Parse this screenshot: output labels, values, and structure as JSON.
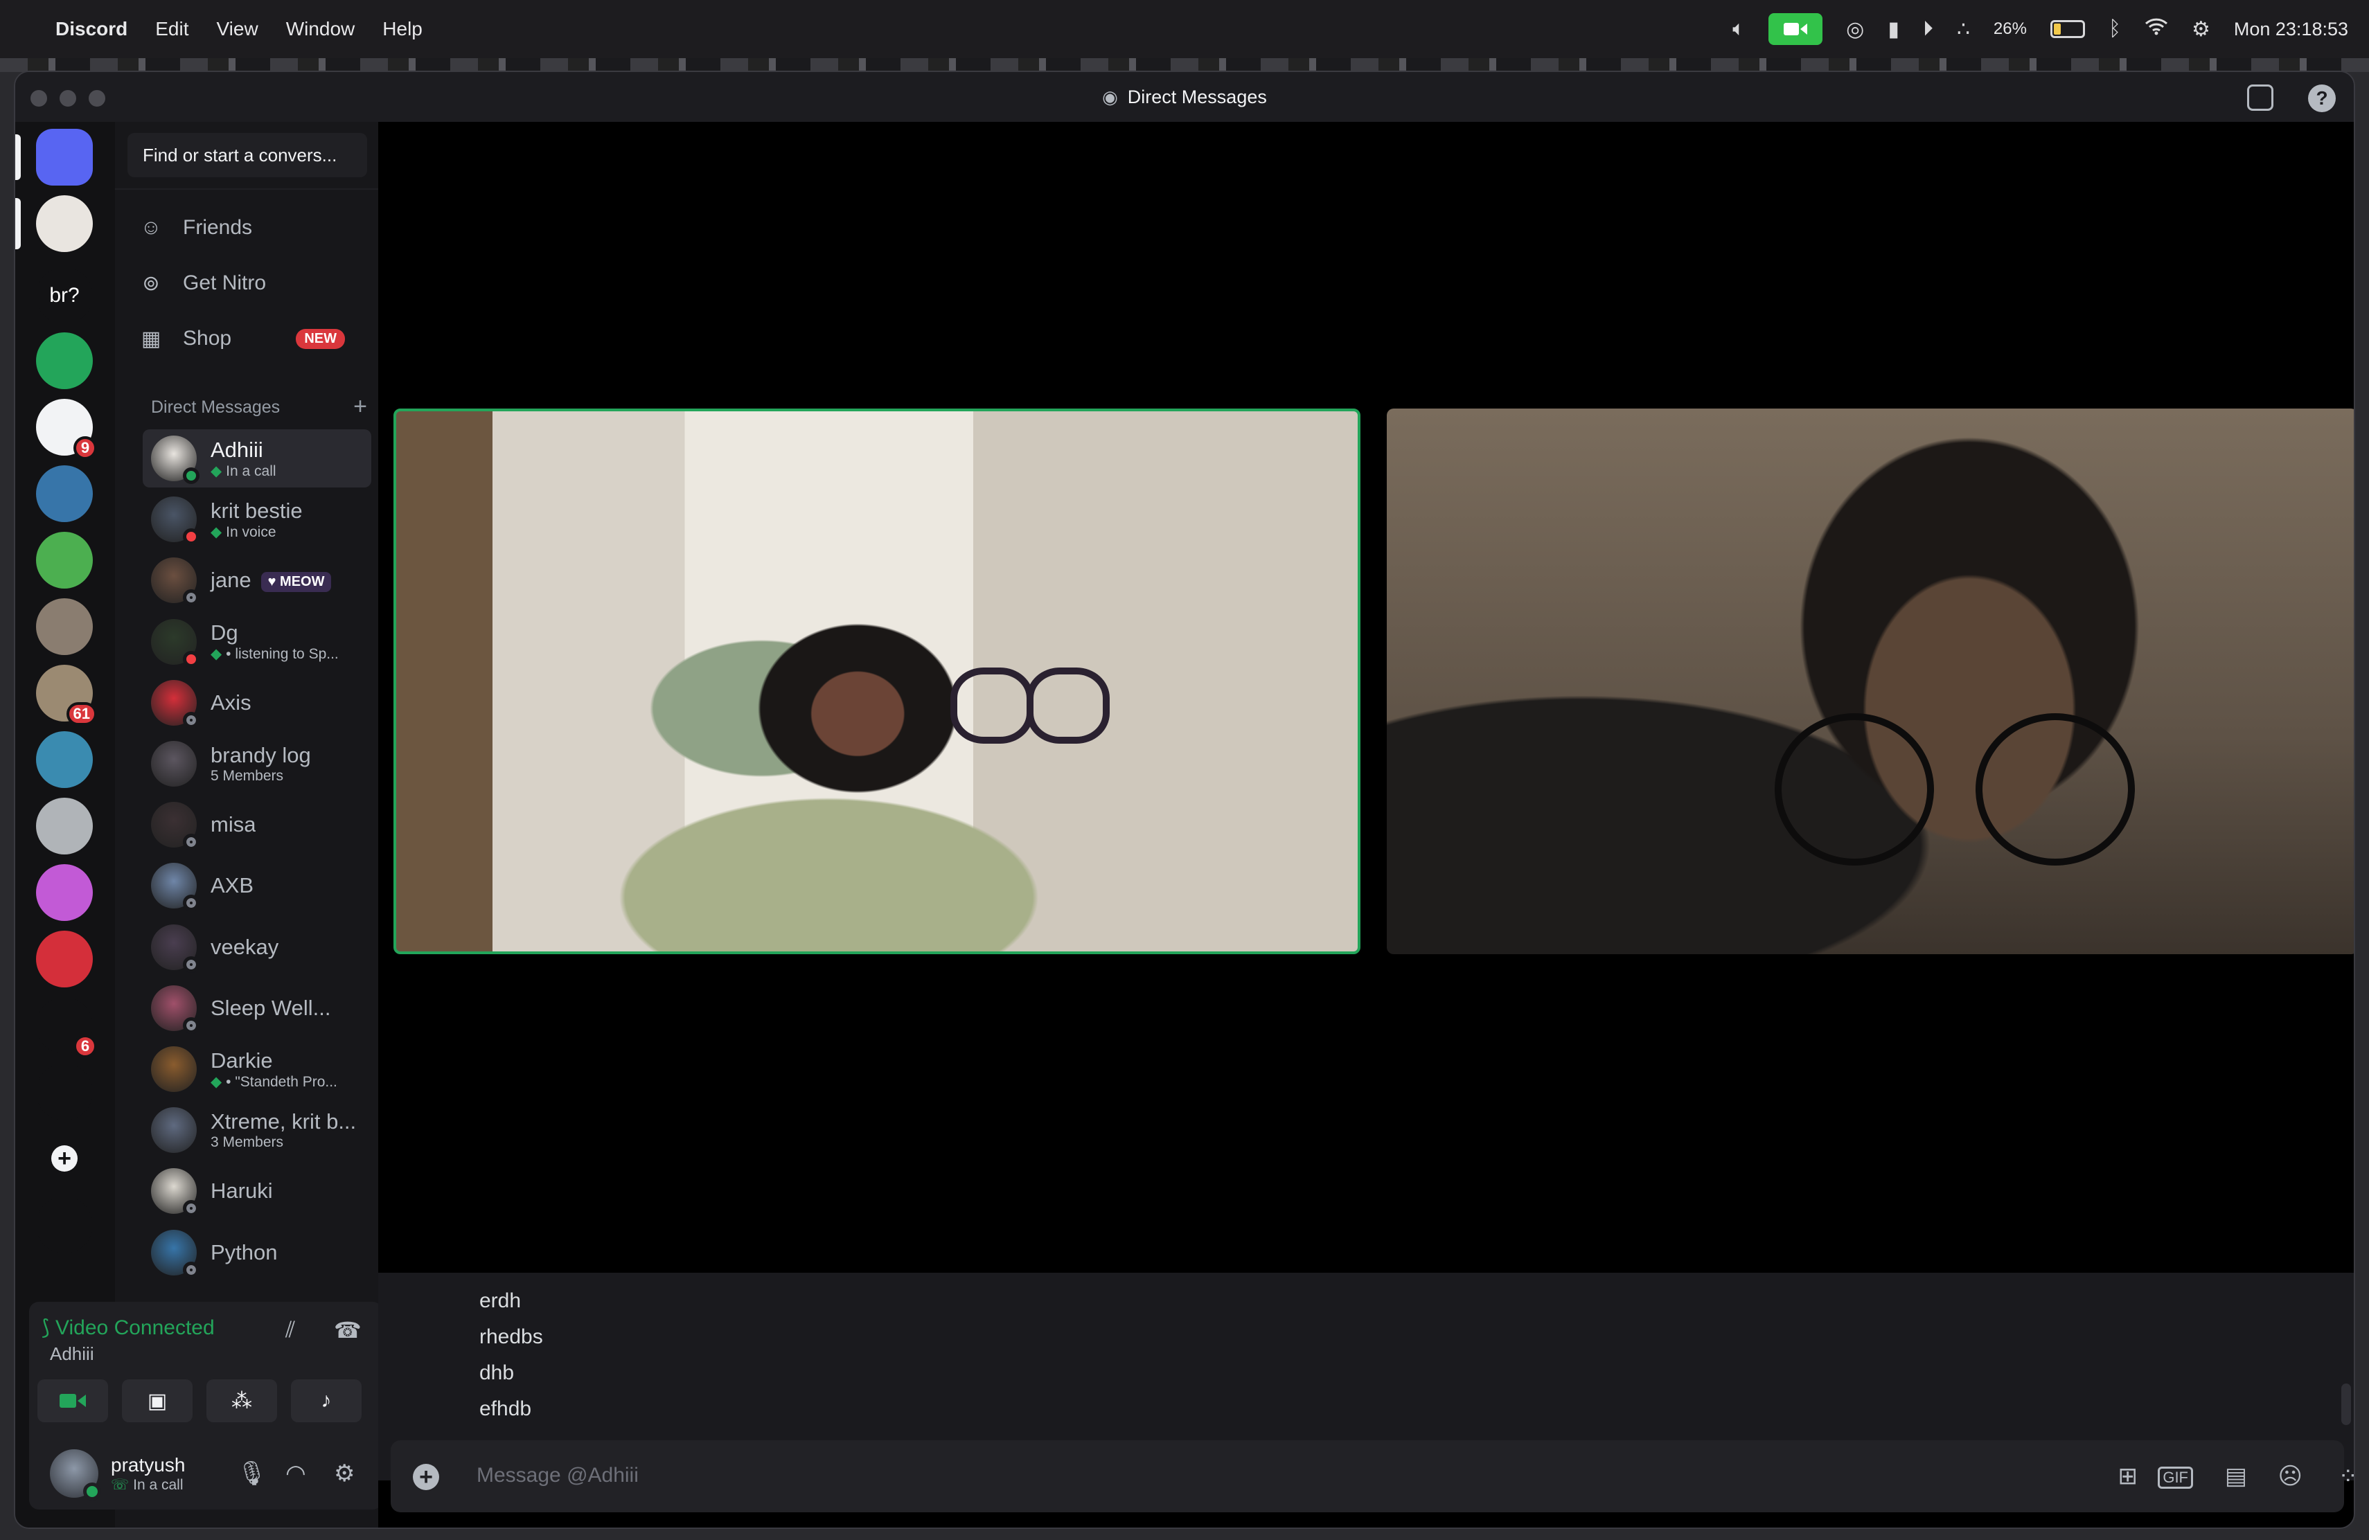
{
  "menubar": {
    "app_name": "Discord",
    "menus": [
      "Edit",
      "View",
      "Window",
      "Help"
    ],
    "battery_percent": "26%",
    "battery_level": 0.26,
    "clock": "Mon 23:18:53"
  },
  "window": {
    "title": "Direct Messages"
  },
  "servers": [
    {
      "label": "",
      "icon": "discord-home-icon",
      "color": "#5865f2"
    },
    {
      "label": "",
      "icon": "user-avatar",
      "color": "#e9e5e0"
    },
    {
      "label": "br?",
      "icon": "",
      "color": "#121214"
    },
    {
      "label": "",
      "icon": "head-logo-icon",
      "color": "#23a55a"
    },
    {
      "label": "",
      "icon": "anime-avatar",
      "color": "#f2f3f5",
      "badge": "9"
    },
    {
      "label": "",
      "icon": "python-logo",
      "color": "#3775a9"
    },
    {
      "label": "",
      "icon": "game-character-icon",
      "color": "#4caf50"
    },
    {
      "label": "",
      "icon": "photo-server",
      "color": "#8a7d70"
    },
    {
      "label": "",
      "icon": "landscape-server",
      "color": "#9b8a72",
      "badge": "61"
    },
    {
      "label": "",
      "icon": "cat-avatar",
      "color": "#3a8bb0"
    },
    {
      "label": "",
      "icon": "drone-server",
      "color": "#b0b4b8"
    },
    {
      "label": "",
      "icon": "rainbow-cat-server",
      "color": "#c25ad6"
    },
    {
      "label": "",
      "icon": "red-server",
      "color": "#d42f3a"
    },
    {
      "label": "",
      "icon": "rainbow-ring-server",
      "color": "#121214",
      "badge": "6"
    },
    {
      "label": "",
      "icon": "network-icon",
      "color": "#121214"
    },
    {
      "label": "+",
      "icon": "add-server-icon",
      "color": "#121214"
    },
    {
      "label": "",
      "icon": "explore-icon",
      "color": "#121214"
    }
  ],
  "sidebar": {
    "search_placeholder": "Find or start a convers...",
    "nav": [
      {
        "label": "Friends",
        "icon": "friends-icon"
      },
      {
        "label": "Get Nitro",
        "icon": "nitro-icon"
      },
      {
        "label": "Shop",
        "icon": "shop-icon",
        "badge": "NEW"
      }
    ],
    "dm_header": "Direct Messages",
    "dms": [
      {
        "name": "Adhiii",
        "sub": "In a call",
        "status": "online",
        "active": true,
        "color": "#e8e4df"
      },
      {
        "name": "krit bestie",
        "sub": "In voice",
        "status": "dnd",
        "color": "#4a5566"
      },
      {
        "name": "jane",
        "tag": "MEOW",
        "status": "off",
        "color": "#6b4f40"
      },
      {
        "name": "Dg",
        "sub": "• listening to Sp...",
        "status": "dnd",
        "color": "#2c3a2a"
      },
      {
        "name": "Axis",
        "status": "off",
        "color": "#d42f3a"
      },
      {
        "name": "brandy log",
        "sub": "5 Members",
        "status": "",
        "color": "#5c5660"
      },
      {
        "name": "misa",
        "status": "off",
        "color": "#3b3033"
      },
      {
        "name": "AXB",
        "status": "off",
        "color": "#6f86a8"
      },
      {
        "name": "veekay",
        "status": "off",
        "color": "#4a3e50"
      },
      {
        "name": "Sleep Well...",
        "status": "off",
        "color": "#a0506a"
      },
      {
        "name": "Darkie",
        "sub": "• \"Standeth Pro...",
        "status": "",
        "color": "#8a5c2e"
      },
      {
        "name": "Xtreme, krit b...",
        "sub": "3 Members",
        "status": "",
        "color": "#5f6a80"
      },
      {
        "name": "Haruki",
        "status": "off",
        "color": "#dcd8d0"
      },
      {
        "name": "Python",
        "status": "off",
        "color": "#3775a9"
      }
    ]
  },
  "voice": {
    "status": "Video Connected",
    "channel": "Adhiii"
  },
  "user": {
    "name": "pratyush",
    "status": "In a call"
  },
  "chat": {
    "messages": [
      "erdh",
      "rhedbs",
      "dhb",
      "efhdb"
    ],
    "composer_placeholder": "Message @Adhiii"
  }
}
